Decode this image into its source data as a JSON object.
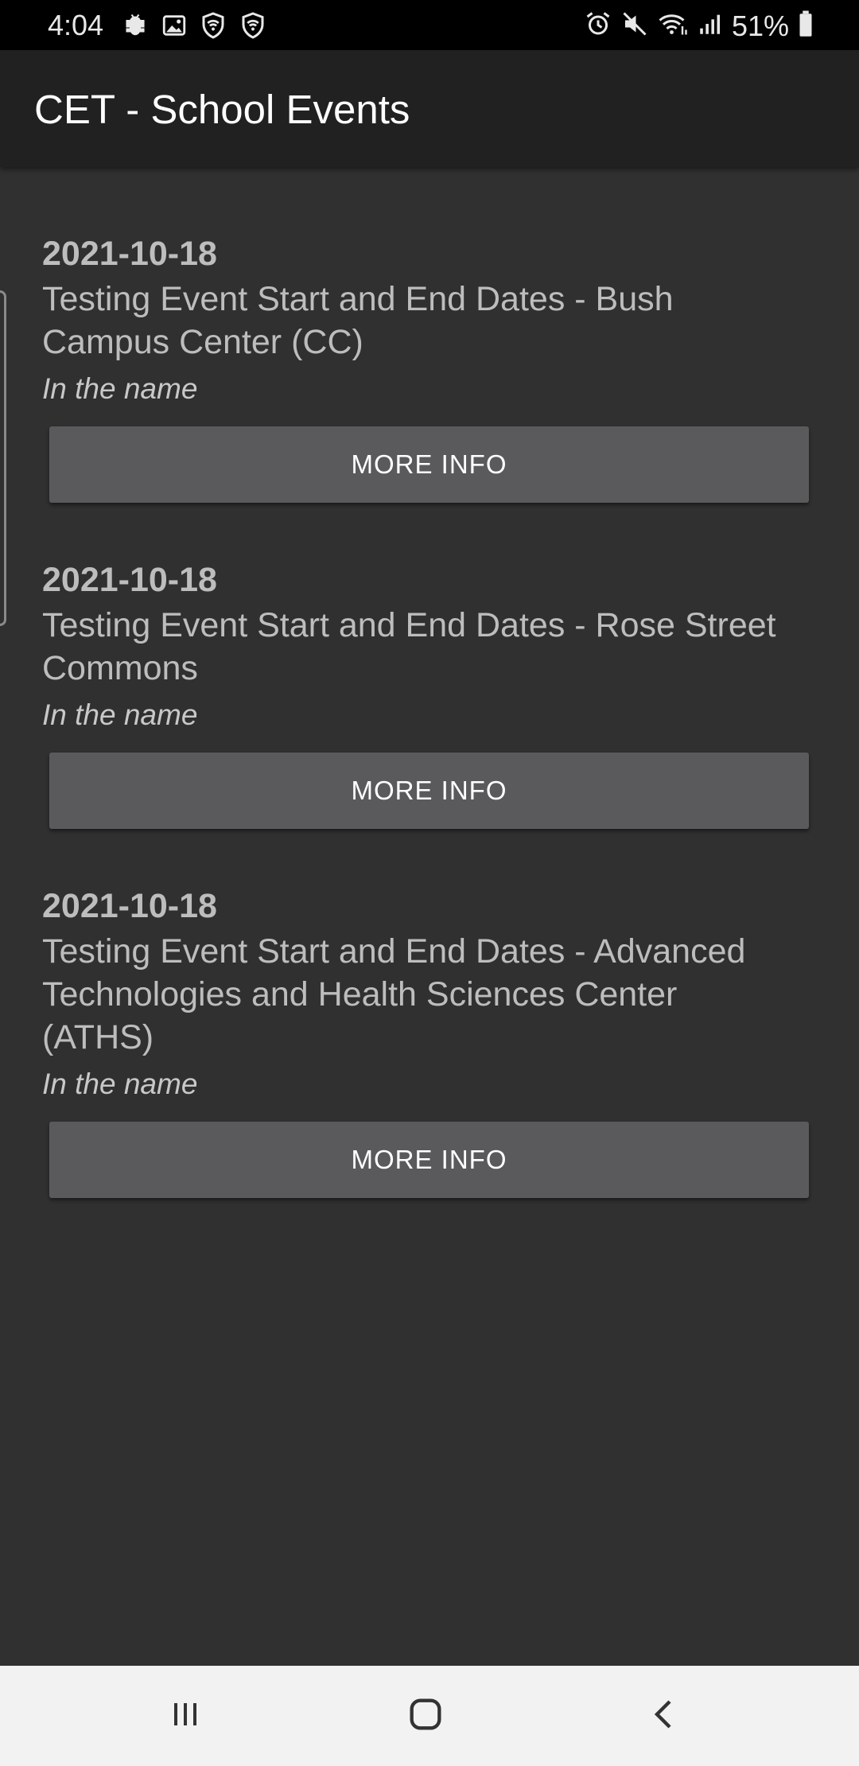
{
  "status_bar": {
    "time": "4:04",
    "battery": "51%",
    "left_icons": [
      "bug-icon",
      "image-icon",
      "shield-wifi-icon",
      "shield-wifi-icon"
    ],
    "right_icons": [
      "alarm-icon",
      "mute-icon",
      "wifi-icon",
      "signal-icon",
      "battery-icon"
    ]
  },
  "app_bar": {
    "title": "CET - School Events"
  },
  "events": [
    {
      "date": "2021-10-18",
      "title_lines": [
        "Testing Event Start and End Dates - Bush",
        "Campus Center (CC)"
      ],
      "description": "In the name",
      "button": "MORE INFO"
    },
    {
      "date": "2021-10-18",
      "title_lines": [
        "Testing Event Start and End Dates - Rose Street",
        "Commons"
      ],
      "description": "In the name",
      "button": "MORE INFO"
    },
    {
      "date": "2021-10-18",
      "title_lines": [
        "Testing Event Start and End Dates - Advanced",
        "Technologies and Health Sciences Center",
        "(ATHS)"
      ],
      "description": "In the name",
      "button": "MORE INFO"
    }
  ],
  "nav_bar": {
    "icons": [
      "recents-icon",
      "home-icon",
      "back-icon"
    ]
  },
  "colors": {
    "background": "#303030",
    "app_bar": "#212121",
    "button": "#5a5a5c",
    "text": "#bdbdbd"
  }
}
